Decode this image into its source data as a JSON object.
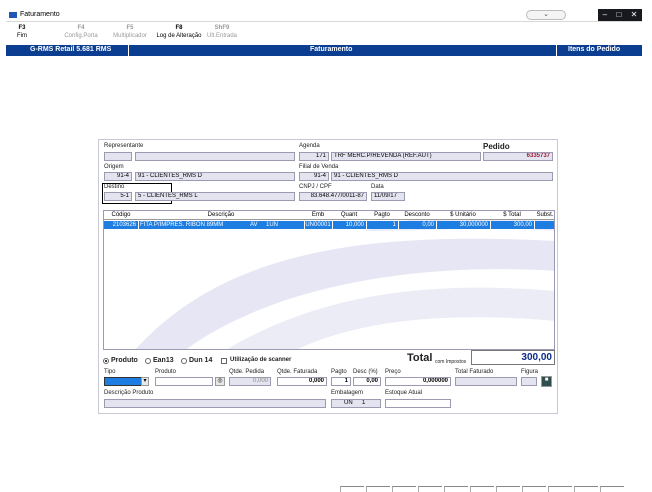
{
  "window": {
    "title": "Faturamento",
    "minimize": "–",
    "maximize": "□",
    "close": "✕"
  },
  "fkeys": [
    {
      "key": "F3",
      "label": "Fim",
      "enabled": true
    },
    {
      "key": "F4",
      "label": "Config.Porta",
      "enabled": false
    },
    {
      "key": "F5",
      "label": "Multiplicador",
      "enabled": false
    },
    {
      "key": "F8",
      "label": "Log de Alteração",
      "enabled": true
    },
    {
      "key": "ShF9",
      "label": "Ult.Entrada",
      "enabled": false
    }
  ],
  "bluebar": {
    "app": "G-RMS Retail 5.681 RMS",
    "section": "Faturamento",
    "right": "Itens do Pedido"
  },
  "header": {
    "representante_label": "Representante",
    "representante_code": "",
    "representante_name": "",
    "agenda_label": "Agenda",
    "agenda_code": "171",
    "agenda_name": "TRF MERC.P/REVENDA (REF.AUT)",
    "pedido_label": "Pedido",
    "pedido_value": "6335737",
    "origem_label": "Origem",
    "origem_code": "91-4",
    "origem_name": "91 - CLIENTES_RMS   D",
    "filial_label": "Filial de Venda",
    "filial_code": "91-4",
    "filial_name": "91 - CLIENTES_RMS   D",
    "destino_label": "Destino",
    "destino_code": "5-1",
    "destino_name": "5 - CLIENTES_RMS   L",
    "cnpj_label": "CNPJ / CPF",
    "cnpj_value": "83.648.477/0011-87",
    "data_label": "Data",
    "data_value": "11/09/17"
  },
  "grid": {
    "columns": [
      "Código",
      "Descrição",
      "Emb",
      "Quant",
      "Pagto",
      "Desconto",
      "$ Unitário",
      "$ Total",
      "Subst."
    ],
    "rows": [
      [
        "2103626",
        "FITA P/IMPRES. RIBON 89MM",
        "AV",
        "1UN",
        "UN00001",
        "10,000",
        "1",
        "0,00",
        "30,000000",
        "300,00",
        ""
      ]
    ]
  },
  "search": {
    "produto": "Produto",
    "ean13": "Ean13",
    "dun14": "Dun 14",
    "scanner": "Utilização de scanner",
    "selected": "Produto"
  },
  "total": {
    "label": "Total",
    "sublabel": "com Impostos",
    "value": "300,00"
  },
  "entry": {
    "tipo_label": "Tipo",
    "tipo_value": "",
    "produto_label": "Produto",
    "produto_value": "",
    "qtde_pedida_label": "Qtde. Pedida",
    "qtde_pedida_value": "0,000",
    "qtde_faturada_label": "Qtde. Faturada",
    "qtde_faturada_value": "0,000",
    "pagto_label": "Pagto",
    "pagto_value": "1",
    "desc_label": "Desc (%)",
    "desc_value": "0,00",
    "preco_label": "Preço",
    "preco_value": "0,000000",
    "total_faturado_label": "Total Faturado",
    "total_faturado_value": "",
    "figura_label": "Figura",
    "descricao_label": "Descrição Produto",
    "descricao_value": "",
    "embalagem_label": "Embalagem",
    "embalagem_un": "UN",
    "embalagem_qty": "1",
    "estoque_label": "Estoque Atual",
    "estoque_value": ""
  },
  "colors": {
    "header_blue": "#0b3d91",
    "selected_row": "#1e7de0",
    "pedido_red": "#9b1f3a",
    "total_blue": "#0b2a8a"
  }
}
